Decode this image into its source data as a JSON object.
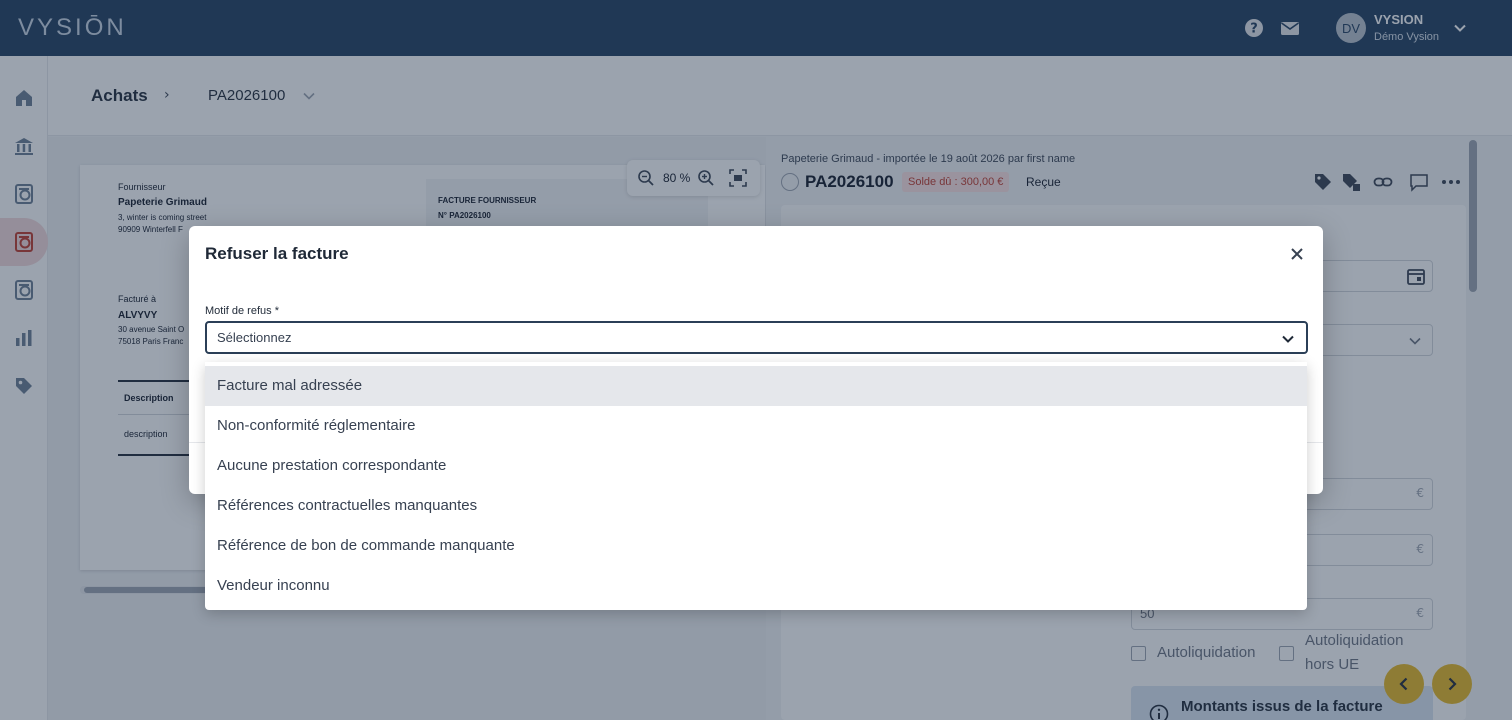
{
  "header": {
    "logo": "VYSIŌN",
    "user_initials": "DV",
    "user_name": "VYSION",
    "user_org": "Démo Vysion"
  },
  "sidebar": {
    "items": [
      "home-icon",
      "bank-icon",
      "sales-invoices-icon",
      "purchase-invoices-icon",
      "receipts-icon",
      "reports-icon",
      "tags-icon"
    ],
    "active_index": 3,
    "accent_color": "#c0392b"
  },
  "breadcrumb": {
    "root": "Achats",
    "separator": "›",
    "current": "PA2026100"
  },
  "preview": {
    "zoom": "80 %",
    "supplier_label": "Fournisseur",
    "supplier_name": "Papeterie Grimaud",
    "supplier_address_1": "3, winter is coming street",
    "supplier_address_2": "90909 Winterfell F",
    "invoice_box_title": "FACTURE FOURNISSEUR",
    "invoice_box_number": "N° PA2026100",
    "billed_label": "Facturé à",
    "billed_name": "ALVYVY",
    "billed_address_1": "30 avenue Saint O",
    "billed_address_2": "75018 Paris Franc",
    "col_description": "Description",
    "row_description": "description"
  },
  "invoice": {
    "import_line": "Papeterie Grimaud - importée le 19 août 2026 par first name",
    "number": "PA2026100",
    "due_badge": "Solde dû : 300,00 €",
    "status": "Reçue",
    "euro_symbol": "€",
    "vat_value": "50",
    "autoliquidation": "Autoliquidation",
    "autoliquidation_hors_ue_1": "Autoliquidation",
    "autoliquidation_hors_ue_2": "hors UE",
    "amounts_title": "Montants issus de la facture"
  },
  "modal": {
    "title": "Refuser la facture",
    "field_label": "Motif de refus *",
    "placeholder": "Sélectionnez",
    "options": [
      "Facture mal adressée",
      "Non-conformité réglementaire",
      "Aucune prestation correspondante",
      "Références contractuelles manquantes",
      "Référence de bon de commande manquante",
      "Vendeur inconnu"
    ],
    "highlighted_index": 0
  }
}
